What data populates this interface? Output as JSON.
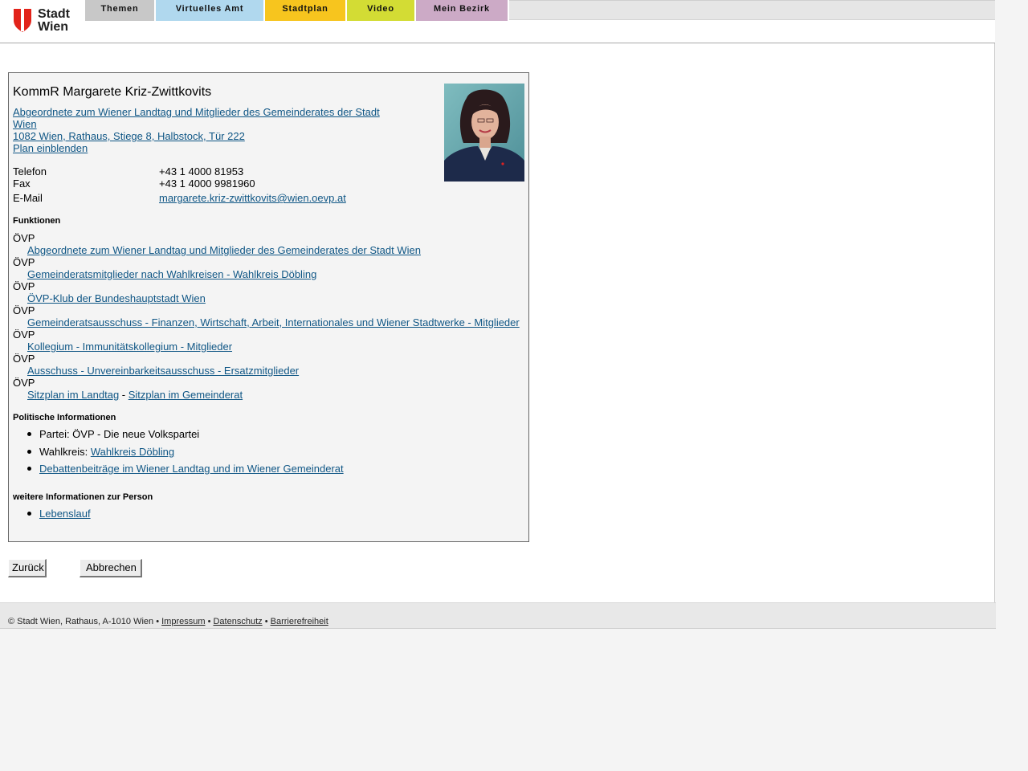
{
  "header": {
    "logo_line1": "Stadt",
    "logo_line2": "Wien",
    "nav": [
      {
        "label": "Themen",
        "color": "#c8c8c8"
      },
      {
        "label": "Virtuelles Amt",
        "color": "#b0d8ee"
      },
      {
        "label": "Stadtplan",
        "color": "#f7c51e"
      },
      {
        "label": "Video",
        "color": "#d3dc34"
      },
      {
        "label": "Mein Bezirk",
        "color": "#ccaac6"
      }
    ]
  },
  "person": {
    "name": "KommR Margarete Kriz-Zwittkovits",
    "role_line1": "Abgeordnete zum Wiener Landtag und Mitglieder des Gemeinderates der Stadt",
    "role_line2": "Wien ",
    "address": "1082 Wien, Rathaus, Stiege 8, Halbstock, Tür 222",
    "plan_link": "Plan einblenden",
    "photo_alt": "Portrait photo"
  },
  "contact": [
    {
      "label": "Telefon",
      "value": "+43 1 4000 81953"
    },
    {
      "label": "Fax",
      "value": "+43 1 4000 9981960"
    },
    {
      "label": "E-Mail",
      "value": "margarete.kriz-zwittkovits@wien.oevp.at"
    }
  ],
  "functions": {
    "heading": "Funktionen",
    "items": [
      {
        "party": "ÖVP",
        "link": "Abgeordnete zum Wiener Landtag und Mitglieder des Gemeinderates der Stadt Wien"
      },
      {
        "party": "ÖVP",
        "link": "Gemeinderatsmitglieder nach Wahlkreisen - Wahlkreis Döbling"
      },
      {
        "party": "ÖVP",
        "link": "ÖVP-Klub der Bundeshauptstadt Wien"
      },
      {
        "party": "ÖVP",
        "link": "Gemeinderatsausschuss - Finanzen, Wirtschaft, Arbeit, Internationales und Wiener Stadtwerke - Mitglieder"
      },
      {
        "party": "ÖVP",
        "link": "Kollegium - Immunitätskollegium - Mitglieder"
      },
      {
        "party": "ÖVP",
        "link": "Ausschuss - Unvereinbarkeitsausschuss - Ersatzmitglieder"
      }
    ],
    "last_party": "ÖVP",
    "seat_link1": "Sitzplan im Landtag",
    "seat_sep": " - ",
    "seat_link2": "Sitzplan im Gemeinderat"
  },
  "political": {
    "heading": "Politische Informationen",
    "party_text": "Partei: ÖVP - Die neue Volkspartei",
    "district_prefix": "Wahlkreis: ",
    "district_link": "Wahlkreis Döbling",
    "debate_link": "Debattenbeiträge im Wiener Landtag und im Wiener Gemeinderat"
  },
  "more": {
    "heading": "weitere Informationen zur Person",
    "cv_link": "Lebenslauf"
  },
  "buttons": {
    "back": "Zurück",
    "cancel": "Abbrechen"
  },
  "footer": {
    "copyright": "© Stadt Wien, Rathaus, A-1010 Wien",
    "sep": " • ",
    "impressum": "Impressum",
    "datenschutz": "Datenschutz",
    "barrierefreiheit": "Barrierefreiheit"
  }
}
